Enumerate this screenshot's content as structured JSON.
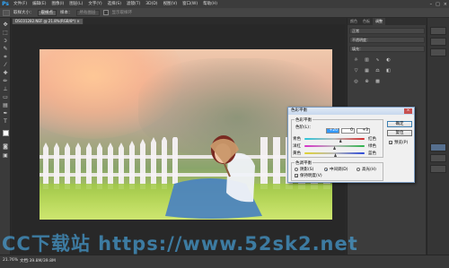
{
  "app": {
    "logo": "Ps"
  },
  "menubar": {
    "items": [
      "文件(F)",
      "编辑(E)",
      "图像(I)",
      "图层(L)",
      "文字(Y)",
      "选择(S)",
      "滤镜(T)",
      "3D(D)",
      "视图(V)",
      "窗口(W)",
      "帮助(H)"
    ],
    "window_controls": {
      "minimize": "–",
      "maximize": "□",
      "close": "×"
    }
  },
  "optionsbar": {
    "size_label": "取样大小：",
    "size_value": "取样点",
    "sample_label": "样本：",
    "sample_value": "所有图层",
    "ring_label": "显示取样环"
  },
  "document": {
    "tab_title": "DSC01282.NEF @ 21.8%(RGB/8*) ×"
  },
  "panels": {
    "tabs": [
      "颜色",
      "色板",
      "调整"
    ],
    "layer_filter": "正常",
    "opacity_label": "不透明度：",
    "fill_label": "填充："
  },
  "dialog": {
    "title": "色彩平衡",
    "close_label": "×",
    "group_balance": "色彩平衡",
    "levels_label": "色阶(L)：",
    "levels": [
      "+20",
      "0",
      "+3"
    ],
    "sliders": [
      {
        "left": "青色",
        "right": "红色",
        "value": 20,
        "left_color": "#29c4d9",
        "right_color": "#d42a2a"
      },
      {
        "left": "洋红",
        "right": "绿色",
        "value": 0,
        "left_color": "#d62fc8",
        "right_color": "#2ab34a"
      },
      {
        "left": "黄色",
        "right": "蓝色",
        "value": 3,
        "left_color": "#e0d230",
        "right_color": "#2a47d8"
      }
    ],
    "group_tone": "色调平衡",
    "tones": [
      {
        "label": "阴影(S)",
        "checked": false
      },
      {
        "label": "中间调(D)",
        "checked": true
      },
      {
        "label": "高光(H)",
        "checked": false
      }
    ],
    "preserve_label": "保持明度(V)",
    "preserve_checked": true,
    "buttons": {
      "ok": "确定",
      "cancel": "复位",
      "preview": "预览(P)"
    },
    "preview_checked": true
  },
  "statusbar": {
    "zoom": "21.76%",
    "doc_info": "文档:39.8M/39.8M"
  },
  "watermark": {
    "text": "CC下载站 https://www.52sk2.net"
  }
}
